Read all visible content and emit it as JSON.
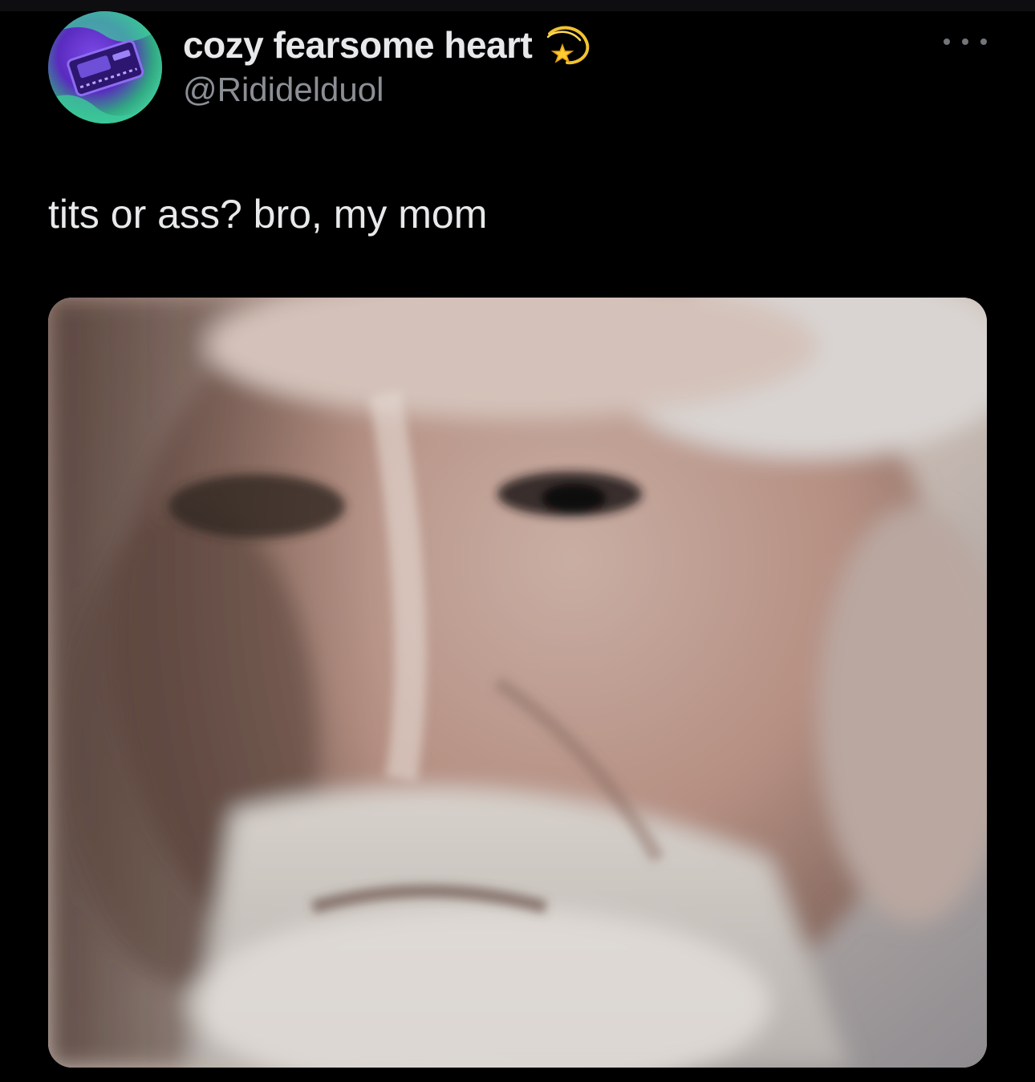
{
  "post": {
    "display_name": "cozy fearsome heart",
    "handle": "@Rididelduol",
    "badge_icon": "dizzy-star-icon",
    "more_icon": "more-options-icon",
    "text": "tits or ass? bro, my mom"
  },
  "media": {
    "description_icon": "photo-icon"
  },
  "colors": {
    "background": "#000000",
    "primary_text": "#e7e9ea",
    "secondary_text": "#8b8f95"
  }
}
